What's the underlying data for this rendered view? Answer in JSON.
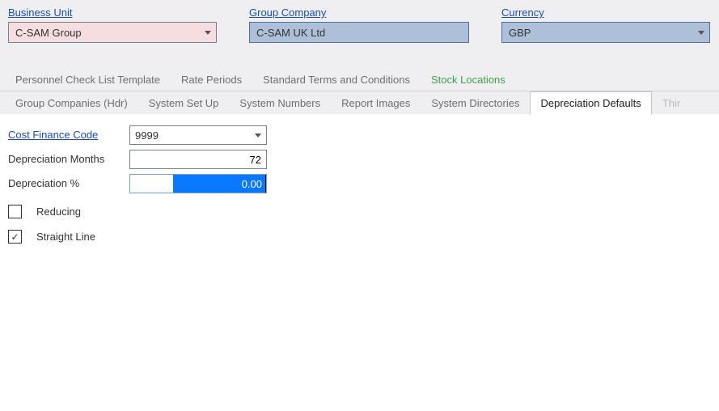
{
  "header": {
    "business_unit_label": "Business Unit",
    "business_unit_value": "C-SAM Group",
    "group_company_label": "Group Company",
    "group_company_value": "C-SAM UK  Ltd",
    "currency_label": "Currency",
    "currency_value": "GBP"
  },
  "tabs_row1": [
    "Personnel Check List Template",
    "Rate Periods",
    "Standard Terms and Conditions",
    "Stock Locations"
  ],
  "tabs_row2": [
    "Group Companies (Hdr)",
    "System Set Up",
    "System Numbers",
    "Report Images",
    "System Directories",
    "Depreciation Defaults",
    "Thir"
  ],
  "active_tab": "Depreciation Defaults",
  "form": {
    "cost_finance_code_label": "Cost Finance Code",
    "cost_finance_code_value": "9999",
    "depr_months_label": "Depreciation Months",
    "depr_months_value": "72",
    "depr_pct_label": "Depreciation %",
    "depr_pct_value": "0.00",
    "reducing_label": "Reducing",
    "reducing_checked": false,
    "straight_label": "Straight Line",
    "straight_checked": true
  }
}
